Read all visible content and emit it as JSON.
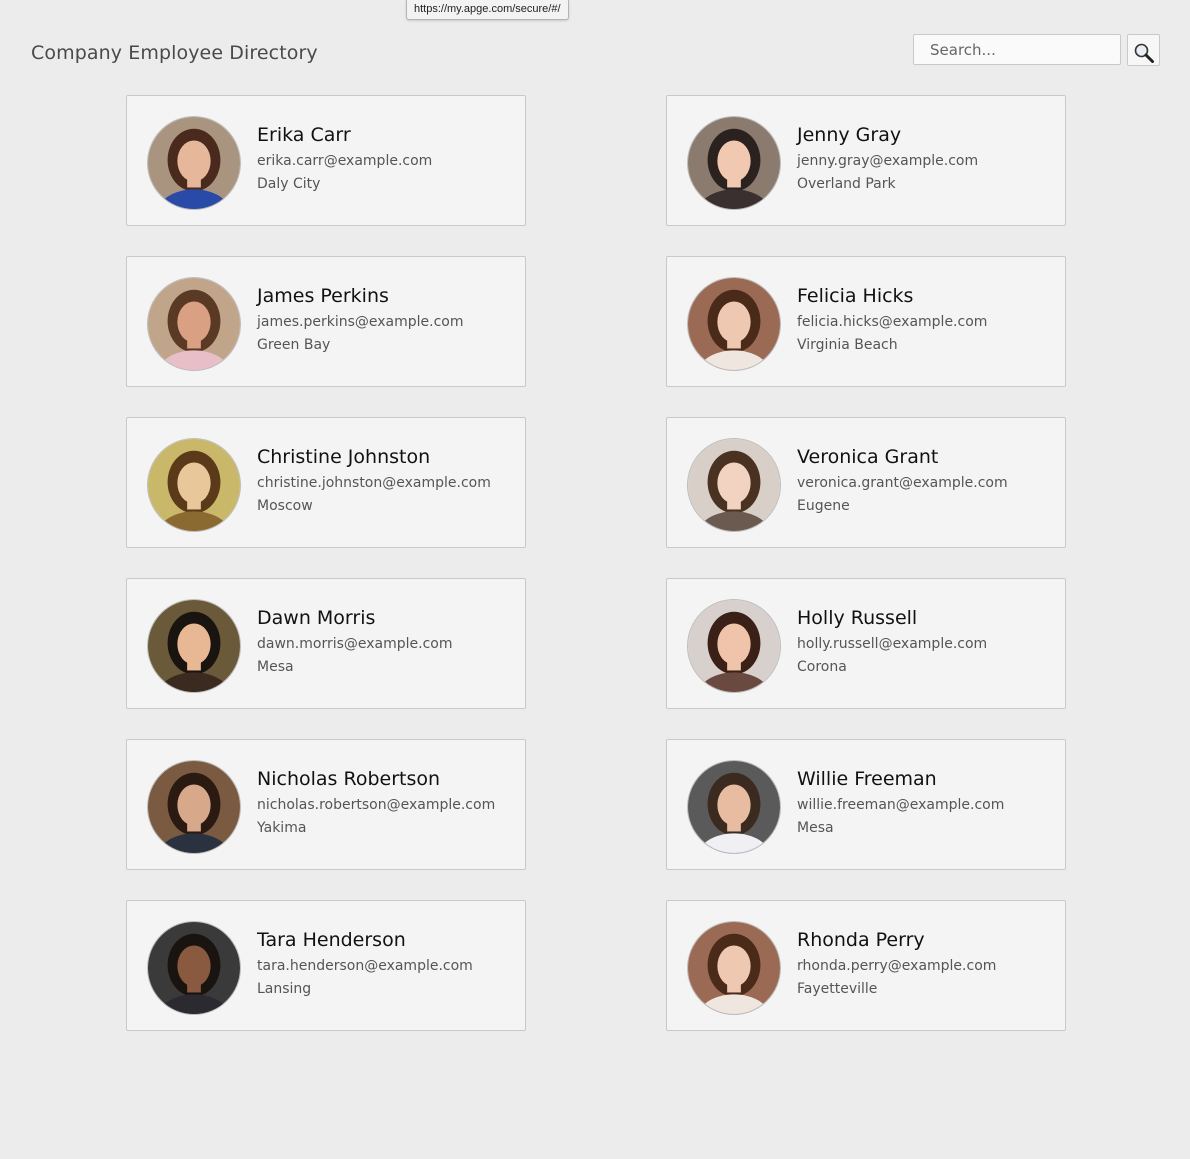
{
  "browser": {
    "status_url": "https://my.apge.com/secure/#/"
  },
  "header": {
    "title": "Company Employee Directory",
    "search_placeholder": "Search...",
    "search_icon": "magnifier-icon"
  },
  "employees": [
    {
      "name": "Erika Carr",
      "email": "erika.carr@example.com",
      "city": "Daly City",
      "bg": "#a9957f",
      "hair": "#4a2a1c",
      "skin": "#e6b79b",
      "shirt": "#2a4aa8"
    },
    {
      "name": "Jenny Gray",
      "email": "jenny.gray@example.com",
      "city": "Overland Park",
      "bg": "#8a7b6e",
      "hair": "#2b2220",
      "skin": "#f0c9b0",
      "shirt": "#3b3030"
    },
    {
      "name": "James Perkins",
      "email": "james.perkins@example.com",
      "city": "Green Bay",
      "bg": "#c0a58a",
      "hair": "#5a3a25",
      "skin": "#d9a084",
      "shirt": "#e8bfc8"
    },
    {
      "name": "Felicia Hicks",
      "email": "felicia.hicks@example.com",
      "city": "Virginia Beach",
      "bg": "#9b6a55",
      "hair": "#4a2a18",
      "skin": "#efc8b2",
      "shirt": "#f0e6e0"
    },
    {
      "name": "Christine Johnston",
      "email": "christine.johnston@example.com",
      "city": "Moscow",
      "bg": "#c9b86a",
      "hair": "#5a3a18",
      "skin": "#e8c79a",
      "shirt": "#8a6a30"
    },
    {
      "name": "Veronica Grant",
      "email": "veronica.grant@example.com",
      "city": "Eugene",
      "bg": "#d8d0c8",
      "hair": "#4a3222",
      "skin": "#f2d2c0",
      "shirt": "#6a5a50"
    },
    {
      "name": "Dawn Morris",
      "email": "dawn.morris@example.com",
      "city": "Mesa",
      "bg": "#6a5a3a",
      "hair": "#1a1410",
      "skin": "#e8b894",
      "shirt": "#3a2a20"
    },
    {
      "name": "Holly Russell",
      "email": "holly.russell@example.com",
      "city": "Corona",
      "bg": "#d8d0cc",
      "hair": "#3a2016",
      "skin": "#f0c4aa",
      "shirt": "#6a4a40"
    },
    {
      "name": "Nicholas Robertson",
      "email": "nicholas.robertson@example.com",
      "city": "Yakima",
      "bg": "#7a5a40",
      "hair": "#2a1a12",
      "skin": "#d8a88a",
      "shirt": "#2a3240"
    },
    {
      "name": "Willie Freeman",
      "email": "willie.freeman@example.com",
      "city": "Mesa",
      "bg": "#5a5a5a",
      "hair": "#3a2a20",
      "skin": "#e8bca0",
      "shirt": "#f0f0f4"
    },
    {
      "name": "Tara Henderson",
      "email": "tara.henderson@example.com",
      "city": "Lansing",
      "bg": "#3a3a3a",
      "hair": "#1a1410",
      "skin": "#8a5a40",
      "shirt": "#2a2a30"
    },
    {
      "name": "Rhonda Perry",
      "email": "rhonda.perry@example.com",
      "city": "Fayetteville",
      "bg": "#9b6a55",
      "hair": "#4a2a18",
      "skin": "#efc8b2",
      "shirt": "#f0e6e0"
    }
  ]
}
